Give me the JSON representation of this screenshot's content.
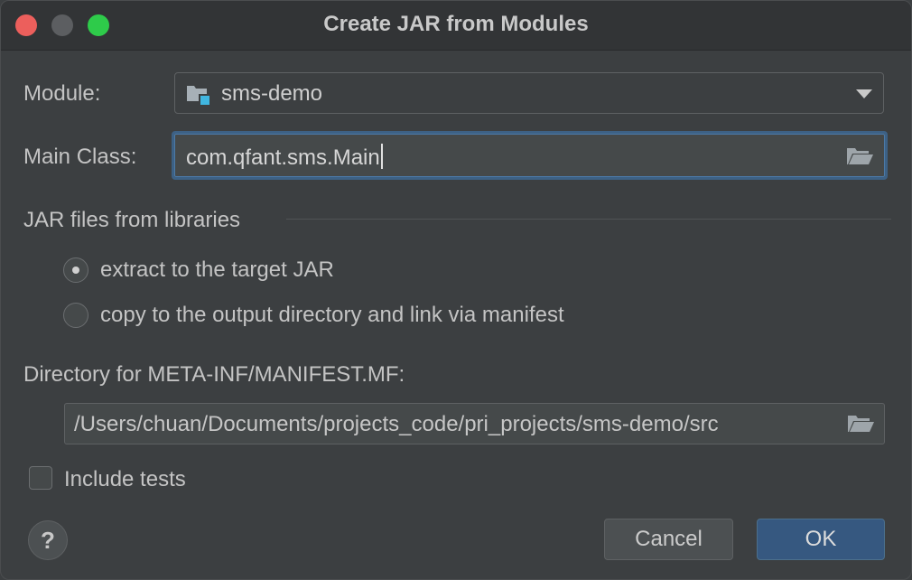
{
  "window": {
    "title": "Create JAR from Modules"
  },
  "module": {
    "label": "Module:",
    "value": "sms-demo",
    "icon": "module-folder-icon"
  },
  "main_class": {
    "label": "Main Class:",
    "value": "com.qfant.sms.Main",
    "icon": "folder-open-icon"
  },
  "jar_files": {
    "section_title": "JAR files from libraries",
    "options": [
      {
        "label": "extract to the target JAR",
        "selected": true
      },
      {
        "label": "copy to the output directory and link via manifest",
        "selected": false
      }
    ]
  },
  "manifest_dir": {
    "label": "Directory for META-INF/MANIFEST.MF:",
    "value": "/Users/chuan/Documents/projects_code/pri_projects/sms-demo/src",
    "icon": "folder-open-icon"
  },
  "include_tests": {
    "label": "Include tests",
    "checked": false
  },
  "buttons": {
    "help": "?",
    "cancel": "Cancel",
    "ok": "OK"
  },
  "colors": {
    "background": "#3c3f41",
    "focus_border": "#3d6185",
    "ok_button": "#365880",
    "close": "#ec5f5c",
    "maximize": "#2ecb4a"
  }
}
